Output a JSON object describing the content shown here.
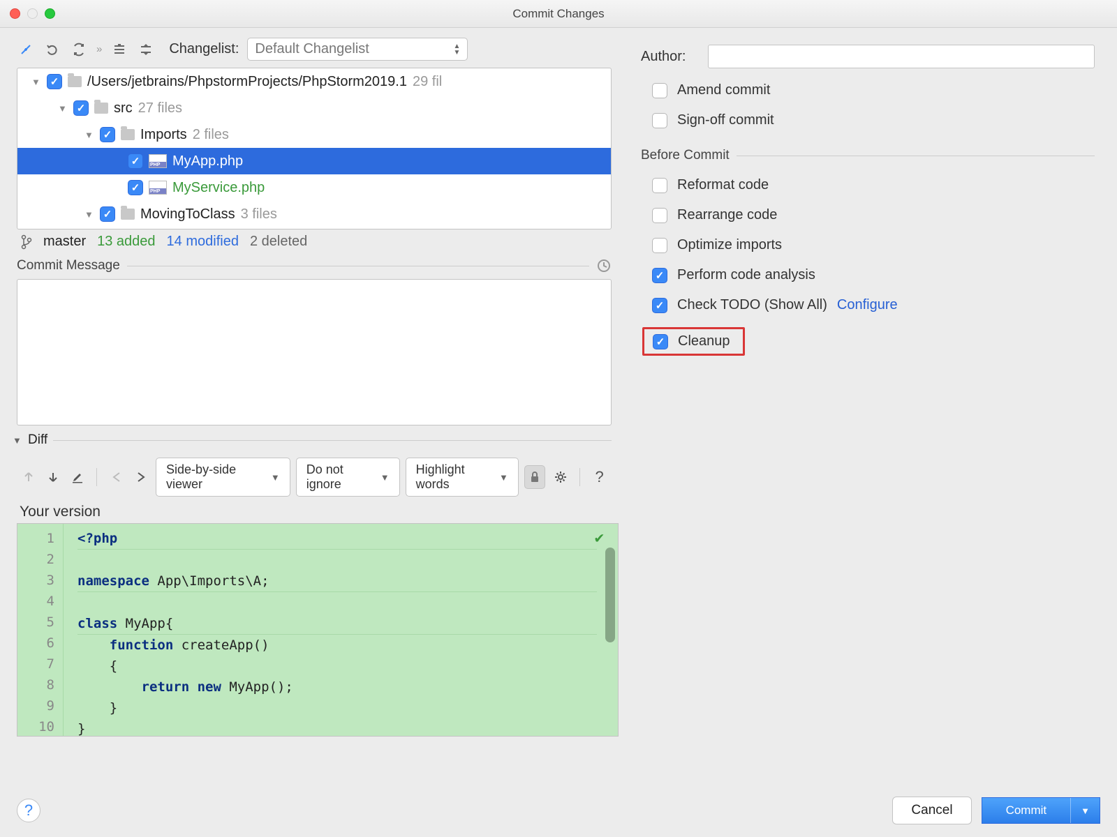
{
  "title": "Commit Changes",
  "toolbar": {
    "changelist_label": "Changelist:",
    "changelist_value": "Default Changelist"
  },
  "tree": {
    "root": {
      "path": "/Users/jetbrains/PhpstormProjects/PhpStorm2019.1",
      "count": "29 fil"
    },
    "src": {
      "label": "src",
      "count": "27 files"
    },
    "imports": {
      "label": "Imports",
      "count": "2 files"
    },
    "files": {
      "myapp": "MyApp.php",
      "myservice": "MyService.php"
    },
    "moving": {
      "label": "MovingToClass",
      "count": "3 files"
    }
  },
  "status": {
    "branch": "master",
    "added": "13 added",
    "modified": "14 modified",
    "deleted": "2 deleted"
  },
  "commit_msg": {
    "title": "Commit Message"
  },
  "diff": {
    "title": "Diff",
    "view_mode": "Side-by-side viewer",
    "ignore": "Do not ignore",
    "highlight": "Highlight words",
    "your_version": "Your version"
  },
  "code": {
    "lines": [
      "1",
      "2",
      "3",
      "4",
      "5",
      "6",
      "7",
      "8",
      "9",
      "10"
    ],
    "l1": "<?php",
    "l3a": "namespace",
    "l3b": " App\\Imports\\A;",
    "l5a": "class",
    "l5b": " MyApp{",
    "l6a": "    function",
    "l6b": " createApp()",
    "l7": "    {",
    "l8a": "        return new",
    "l8b": " MyApp();",
    "l9": "    }",
    "l10": "}"
  },
  "right": {
    "author_label": "Author:",
    "amend": "Amend commit",
    "signoff": "Sign-off commit",
    "before_commit": "Before Commit",
    "reformat": "Reformat code",
    "rearrange": "Rearrange code",
    "optimize": "Optimize imports",
    "analysis": "Perform code analysis",
    "todo": "Check TODO (Show All)",
    "configure": "Configure",
    "cleanup": "Cleanup"
  },
  "footer": {
    "cancel": "Cancel",
    "commit": "Commit"
  }
}
